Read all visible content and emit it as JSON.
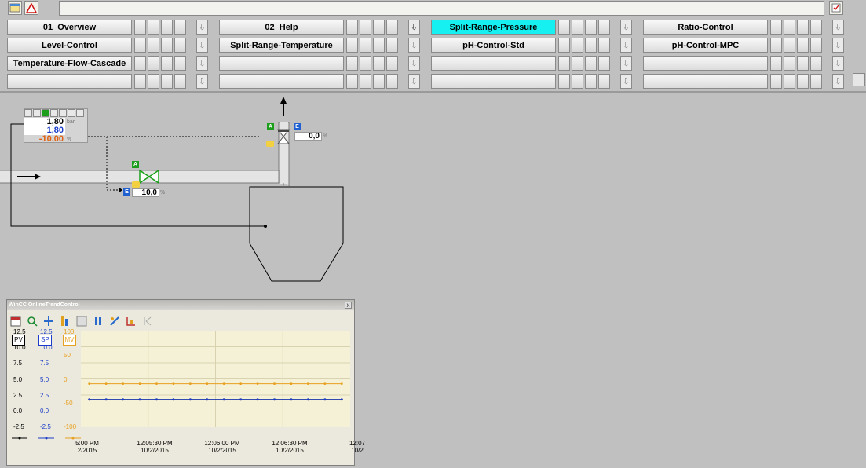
{
  "toolbar": {
    "left_icon_1": "report-icon",
    "left_icon_2": "alarm-warning-icon",
    "right_icon": "checklist-icon"
  },
  "nav": {
    "rows": [
      [
        "01_Overview",
        "02_Help",
        "Split-Range-Pressure",
        "Ratio-Control"
      ],
      [
        "Level-Control",
        "Split-Range-Temperature",
        "pH-Control-Std",
        "pH-Control-MPC"
      ],
      [
        "Temperature-Flow-Cascade",
        "",
        "",
        ""
      ],
      [
        "",
        "",
        "",
        ""
      ]
    ],
    "active": "Split-Range-Pressure",
    "arrow_glyph": "⇩"
  },
  "faceplate": {
    "pv": "1,80",
    "pv_unit": "bar",
    "sp": "1,80",
    "out": "-10,00",
    "out_unit": "%"
  },
  "valve_top": {
    "value": "0,0",
    "unit": "%",
    "tag_a": "A",
    "tag_e": "E"
  },
  "valve_mid": {
    "value": "10,0",
    "unit": "%",
    "tag_a": "A",
    "tag_e": "E"
  },
  "trend": {
    "title": "WinCC OnlineTrendControl",
    "close": "x",
    "axes": {
      "pv": {
        "label": "PV",
        "ticks": [
          "12.5",
          "10.0",
          "7.5",
          "5.0",
          "2.5",
          "0.0",
          "-2.5"
        ],
        "color": "#000000"
      },
      "sp": {
        "label": "SP",
        "ticks": [
          "12.5",
          "10.0",
          "7.5",
          "5.0",
          "2.5",
          "0.0",
          "-2.5"
        ],
        "color": "#1a3cc8"
      },
      "mv": {
        "label": "MV",
        "ticks": [
          "100",
          "50",
          "0",
          "-50",
          "-100"
        ],
        "color": "#e8a020"
      }
    },
    "x_labels": [
      {
        "time": "5:00 PM",
        "date": "2/2015"
      },
      {
        "time": "12:05:30 PM",
        "date": "10/2/2015"
      },
      {
        "time": "12:06:00 PM",
        "date": "10/2/2015"
      },
      {
        "time": "12:06:30 PM",
        "date": "10/2/2015"
      },
      {
        "time": "12:07",
        "date": "10/2"
      }
    ],
    "colors": {
      "pv": "#000000",
      "sp": "#1a3cc8",
      "mv": "#e8a020",
      "plot_bg": "#f5f1d6"
    }
  },
  "chart_data": {
    "type": "line",
    "title": "",
    "series": [
      {
        "name": "PV",
        "values": [
          1.8,
          1.8,
          1.8,
          1.8,
          1.8,
          1.8,
          1.8,
          1.8,
          1.8,
          1.8,
          1.8,
          1.8,
          1.8,
          1.8,
          1.8,
          1.8
        ]
      },
      {
        "name": "SP",
        "values": [
          1.8,
          1.8,
          1.8,
          1.8,
          1.8,
          1.8,
          1.8,
          1.8,
          1.8,
          1.8,
          1.8,
          1.8,
          1.8,
          1.8,
          1.8,
          1.8
        ]
      },
      {
        "name": "MV",
        "values": [
          -10,
          -10,
          -10,
          -10,
          -10,
          -10,
          -10,
          -10,
          -10,
          -10,
          -10,
          -10,
          -10,
          -10,
          -10,
          -10
        ]
      }
    ],
    "ylim_left": [
      -2.5,
      12.5
    ],
    "ylim_mv": [
      -100,
      100
    ],
    "grid": true
  }
}
